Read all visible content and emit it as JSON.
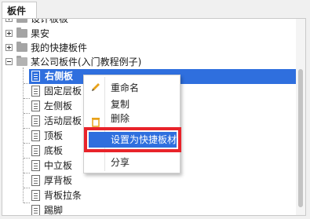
{
  "tab": {
    "label": "板件"
  },
  "tree": {
    "top_partial_label": "设计板板",
    "items": [
      {
        "label": "果安",
        "type": "folder",
        "expanded": false
      },
      {
        "label": "我的快捷板件",
        "type": "folder",
        "expanded": false
      },
      {
        "label": "某公司板件(入门教程例子)",
        "type": "folder",
        "expanded": true,
        "children": [
          {
            "label": "右侧板",
            "selected": true
          },
          {
            "label": "固定层板"
          },
          {
            "label": "左侧板"
          },
          {
            "label": "活动层板"
          },
          {
            "label": "顶板"
          },
          {
            "label": "底板"
          },
          {
            "label": "中立板"
          },
          {
            "label": "厚背板"
          },
          {
            "label": "背板拉条"
          },
          {
            "label": "踢脚"
          }
        ]
      }
    ]
  },
  "context_menu": {
    "items": [
      {
        "label": "重命名",
        "icon": "pencil-icon"
      },
      {
        "label": "复制",
        "icon": ""
      },
      {
        "label": "删除",
        "icon": "trash-icon"
      },
      {
        "label": "设置为快捷板材",
        "icon": "",
        "highlighted": true
      },
      {
        "label": "分享",
        "icon": ""
      }
    ]
  },
  "colors": {
    "selection": "#2f6fde",
    "highlight_border": "#e8232a",
    "pencil_accent": "#e8a21a"
  }
}
